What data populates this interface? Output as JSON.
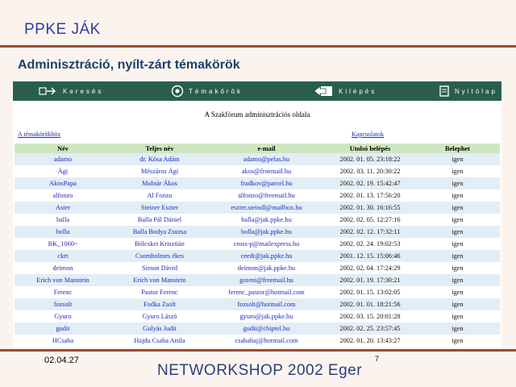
{
  "slide": {
    "title": "PPKE JÁK",
    "subtitle": "Adminisztráció, nyílt-zárt témakörök",
    "date": "02.04.27",
    "page_number": "7",
    "footer": "NETWORKSHOP 2002 Eger"
  },
  "app": {
    "nav": {
      "search": "Keresés",
      "topics": "Témakörök",
      "logout": "Kilépés",
      "home": "Nyitólap"
    },
    "welcome": "A Szakfórum adminisztrációs oldala",
    "links": {
      "topics": "A témakörökhöz",
      "contacts": "Kapcsolatok"
    },
    "table": {
      "headers": [
        "Név",
        "Teljes név",
        "e-mail",
        "Utolsó belépés",
        "Belephet"
      ],
      "rows": [
        [
          "adamo",
          "dr. Kósa Adám",
          "adamo@pelas.hu",
          "2002. 01. 05. 23:18:22",
          "igen"
        ],
        [
          "Ági",
          "Mészáros Ági",
          "akos@froemail.hu",
          "2002. 03. 11. 20:30:22",
          "igen"
        ],
        [
          "AkosPapa",
          "Molnár Ákos",
          "fradkov@parcel.hu",
          "2002. 02. 19. 15:42:47",
          "igen"
        ],
        [
          "alfonzo",
          "Al Fonzo",
          "alfonzo@freemail.hu",
          "2002. 01. 13. 17:56:20",
          "igen"
        ],
        [
          "Aster",
          "Steiner Eszter",
          "eszter.steindl@mailbox.hu",
          "2002. 01. 30. 16:16:55",
          "igen"
        ],
        [
          "balla",
          "Balla Pál Dániel",
          "balla@jak.ppke.hu",
          "2002. 02. 05. 12:27:16",
          "igen"
        ],
        [
          "bolla",
          "Balla Bodya Zsuzsa",
          "bolla@jak.ppke.hu",
          "2002. 02. 12. 17:32:11",
          "igen"
        ],
        [
          "BK_1060~",
          "Bölcskei Krisztián",
          "cross-p@mailexpress.hu",
          "2002. 02. 24. 19:02:53",
          "igen"
        ],
        [
          "ckrt",
          "Csombolmes ékes",
          "ceedt@jak.ppke.hu",
          "2001. 12. 15. 15:06:46",
          "igen"
        ],
        [
          "deimon",
          "Simon Dávid",
          "deimon@jak.ppke.hu",
          "2002. 02. 04. 17:24:29",
          "igen"
        ],
        [
          "Erich von Manstein",
          "Erich von Manstein",
          "goreni@freemail.hu",
          "2002. 01. 19. 17:30:21",
          "igen"
        ],
        [
          "Ferenc",
          "Pastor Ferenc",
          "ferenc_pastor@hotmail.com",
          "2002. 01. 15. 13:02:05",
          "igen"
        ],
        [
          "fozsolt",
          "Fodka Zsolt",
          "fozsolt@hotmail.com",
          "2002. 01. 01. 18:21:56",
          "igen"
        ],
        [
          "Gyuro",
          "Gyuro Lászó",
          "gyuro@jak.ppke.hu",
          "2002. 03. 15. 20:01:28",
          "igen"
        ],
        [
          "gudit",
          "Gulyás Judit",
          "gudit@chiptel.hu",
          "2002. 02. 25. 23:57:45",
          "igen"
        ],
        [
          "HCsaba",
          "Hajdu Csaba Attila",
          "csabahaj@hotmail.com",
          "2002. 01. 20. 13:43:27",
          "igen"
        ]
      ]
    }
  },
  "colors": {
    "navbar": "#295e4d",
    "header_row": "#cfe6c2",
    "link": "#1b2bc0",
    "rule": "#a2472e",
    "title": "#2b3fa0"
  }
}
